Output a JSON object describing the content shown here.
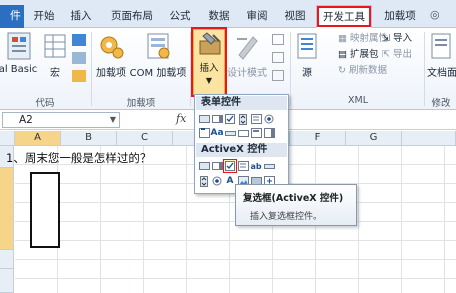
{
  "tabs": {
    "file": "件",
    "items": [
      "开始",
      "插入",
      "页面布局",
      "公式",
      "数据",
      "审阅",
      "视图",
      "开发工具",
      "加载项"
    ]
  },
  "ribbon": {
    "vbasic_label": "al Basic",
    "macro_label": "宏",
    "addins_label": "加载项",
    "com_addins_label": "COM 加载项",
    "insert_label": "插入",
    "design_mode_label": "设计模式",
    "source_label": "源",
    "map_properties_label": "映射属性",
    "expansion_pack_label": "扩展包",
    "refresh_data_label": "刷新数据",
    "import_label": "导入",
    "export_label": "导出",
    "doc_panel_label": "文档面",
    "group_code": "代码",
    "group_addins": "加载项",
    "group_xml": "XML",
    "group_modify": "修改"
  },
  "formula_bar": {
    "name_box": "A2",
    "fx": "fx"
  },
  "grid": {
    "columns": [
      "A",
      "B",
      "C",
      "F",
      "G"
    ],
    "question": "1、周末您一般是怎样过的？"
  },
  "dropdown": {
    "form_controls_title": "表单控件",
    "activex_title": "ActiveX 控件"
  },
  "tooltip": {
    "title": "复选框(ActiveX 控件)",
    "desc": "插入复选框控件。"
  },
  "colors": {
    "highlight_red": "#e8161d",
    "file_blue": "#2b6fc2",
    "ribbon_bg": "#dfe9f5"
  }
}
